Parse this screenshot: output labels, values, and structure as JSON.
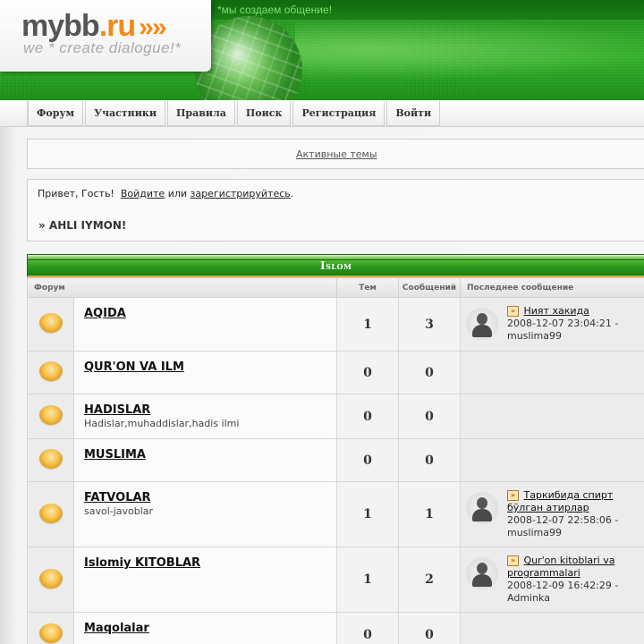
{
  "header": {
    "slogan": "*мы создаем общение!",
    "logo_name": "mybb",
    "logo_domain": ".ru",
    "logo_arrows": "»",
    "logo_tagline": "we * create dialogue!*"
  },
  "nav": [
    "Форум",
    "Участники",
    "Правила",
    "Поиск",
    "Регистрация",
    "Войти"
  ],
  "active_topics": "Активные темы",
  "welcome": {
    "greeting": "Привет, Гость!",
    "login": "Войдите",
    "or": "или",
    "register": "зарегистрируйтесь",
    "end": ".",
    "board_title": "» AHLI IYMON!"
  },
  "category": {
    "title": "Islom",
    "columns": {
      "forum": "Форум",
      "topics": "Тем",
      "posts": "Сообщений",
      "last_post": "Последнее сообщение"
    },
    "forums": [
      {
        "title": "AQIDA",
        "desc": "",
        "topics": "1",
        "posts": "3",
        "last": {
          "subject": "Ният хакида",
          "date": "2008-12-07 23:04:21 -",
          "author": "muslima99"
        }
      },
      {
        "title": "QUR'ON VA ILM",
        "desc": "",
        "topics": "0",
        "posts": "0",
        "last": null
      },
      {
        "title": "HADISLAR",
        "desc": "Hadislar,muhaddislar,hadis ilmi",
        "topics": "0",
        "posts": "0",
        "last": null
      },
      {
        "title": "MUSLIMA",
        "desc": "",
        "topics": "0",
        "posts": "0",
        "last": null
      },
      {
        "title": "FATVOLAR",
        "desc": "savol-javoblar",
        "topics": "1",
        "posts": "1",
        "last": {
          "subject": "Таркибида спирт бўлган атирлар",
          "date": "2008-12-07 22:58:06 -",
          "author": "muslima99"
        }
      },
      {
        "title": "Islomiy KITOBLAR",
        "desc": "",
        "topics": "1",
        "posts": "2",
        "last": {
          "subject": "Qur'on kitoblari va programmalari",
          "date": "2008-12-09 16:42:29 -",
          "author": "Adminka"
        }
      },
      {
        "title": "Maqolalar",
        "desc": "",
        "topics": "0",
        "posts": "0",
        "last": null
      }
    ]
  }
}
